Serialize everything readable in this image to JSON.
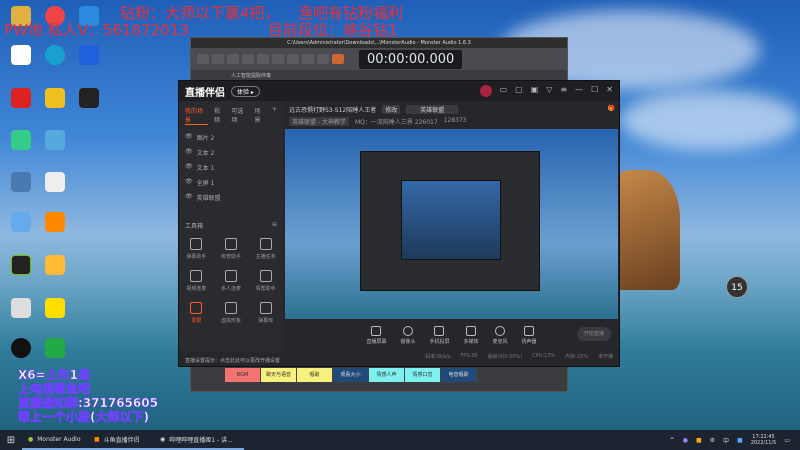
{
  "overlay": {
    "line1": "钻粉：大师以下赢4把，",
    "line1b": "渔吧有钻粉福利",
    "line2": "PW地 私人V：561872013",
    "line2b": "目前段位：峡谷钻1"
  },
  "monster_audio": {
    "title": "C:\\Users\\Administrator\\Downloads\\...\\MonsterAudio - Monster Audio 1.6.3",
    "time": "00:00:00.000",
    "tab": "人工智能提取伴奏"
  },
  "app": {
    "logo": "直播伴侣",
    "pill": "体验 ▸",
    "header_icons": [
      "▭",
      "▢",
      "▣",
      "▽",
      "≡",
      "—",
      "☐",
      "✕"
    ],
    "tabs": [
      "我的场景",
      "视频",
      "可选项",
      "场景"
    ],
    "layers": [
      "图片 2",
      "文本 2",
      "文本 1",
      "全屏 1",
      "英雄联盟"
    ],
    "room_title": "远古恐惧打野S3-S12陪睡人王者",
    "edit": "修改",
    "category": "英雄联盟",
    "sub": "英雄联盟 - 大神教学",
    "mq": "MQ：一流陪睡人三界 226017",
    "hot": "128373",
    "toolbox": "工具箱",
    "tools": [
      "弹幕助手",
      "房管助手",
      "主播任务",
      "视频连麦",
      "多人连麦",
      "情帮助手",
      "录屏",
      "虚拟形象",
      "弹幕库"
    ],
    "controls": [
      "直播屏幕",
      "摄像头",
      "手机投屏",
      "多媒体",
      "麦克风",
      "扬声器"
    ],
    "live": "开始直播",
    "status": [
      "码率:0kb/s",
      "FPS:30",
      "丢帧:0(0.00%)",
      "CPU:13%",
      "内存:15%",
      "未开播"
    ],
    "notice": "直播设置提示：点击此处可以更改开播设置"
  },
  "mixer": [
    "BGM",
    "聊天与语音",
    "唱歌",
    "观看大小",
    "情感人声",
    "情感口音",
    "电音唱歌"
  ],
  "bottom": [
    "X6=上车1局",
    "上电视看鱼吧",
    "直播通知群:371765605",
    "帮上一个小段(大师以下)"
  ],
  "bubble": "15",
  "taskbar": {
    "tasks": [
      "Monster Audio",
      "斗鱼直播伴侣",
      "哔哩哔哩直播姬1 - 讲..."
    ],
    "time": "17:22:45",
    "date": "2022/11/5",
    "ime": "中"
  }
}
